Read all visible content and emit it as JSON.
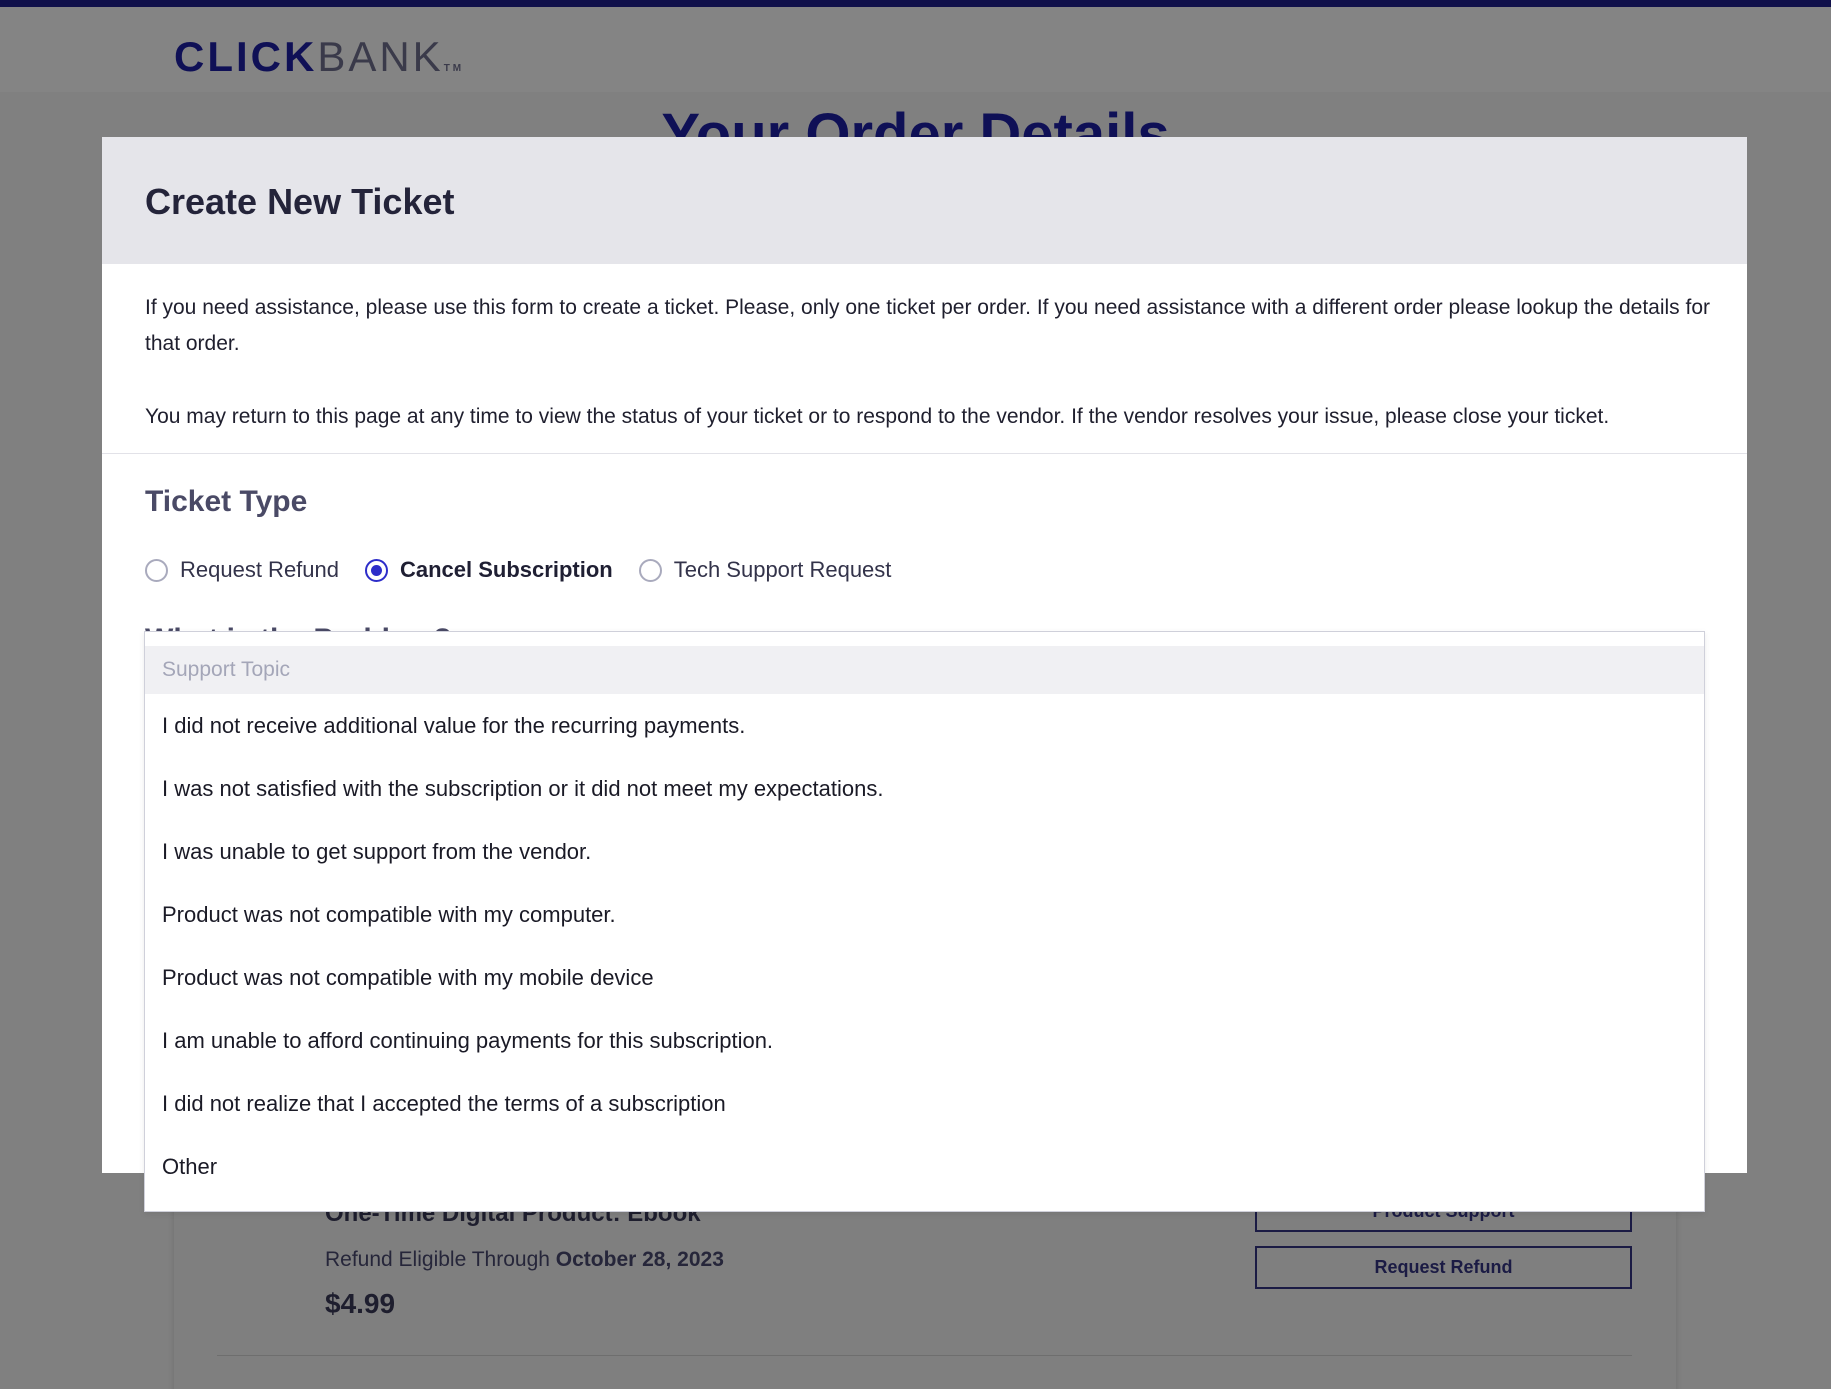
{
  "header": {
    "logo_click": "CLICK",
    "logo_bank": "BANK",
    "logo_tm": "TM"
  },
  "page": {
    "title": "Your Order Details"
  },
  "product": {
    "title": "One-Time Digital Product: Ebook",
    "refund_eligible_prefix": "Refund Eligible Through",
    "refund_eligible_date": "October 28, 2023",
    "price": "$4.99",
    "product_support_label": "Product Support",
    "request_refund_label": "Request Refund"
  },
  "modal": {
    "title": "Create New Ticket",
    "intro_paragraph_1": "If you need assistance, please use this form to create a ticket. Please, only one ticket per order. If you need assistance with a different order please lookup the details for that order.",
    "intro_paragraph_2": "You may return to this page at any time to view the status of your ticket or to respond to the vendor. If the vendor resolves your issue, please close your ticket.",
    "ticket_type_heading": "Ticket Type",
    "ticket_types": [
      {
        "label": "Request Refund",
        "selected": false
      },
      {
        "label": "Cancel Subscription",
        "selected": true
      },
      {
        "label": "Tech Support Request",
        "selected": false
      }
    ],
    "problem_heading": "What is the Problem?"
  },
  "dropdown": {
    "placeholder": "Support Topic",
    "options": [
      "I did not receive additional value for the recurring payments.",
      "I was not satisfied with the subscription or it did not meet my expectations.",
      "I was unable to get support from the vendor.",
      "Product was not compatible with my computer.",
      "Product was not compatible with my mobile device",
      "I am unable to afford continuing payments for this subscription.",
      "I did not realize that I accepted the terms of a subscription",
      "Other"
    ]
  },
  "colors": {
    "brand_navy": "#0f1056",
    "accent_blue": "#2d2dc9",
    "overlay_gray": "#808080"
  }
}
